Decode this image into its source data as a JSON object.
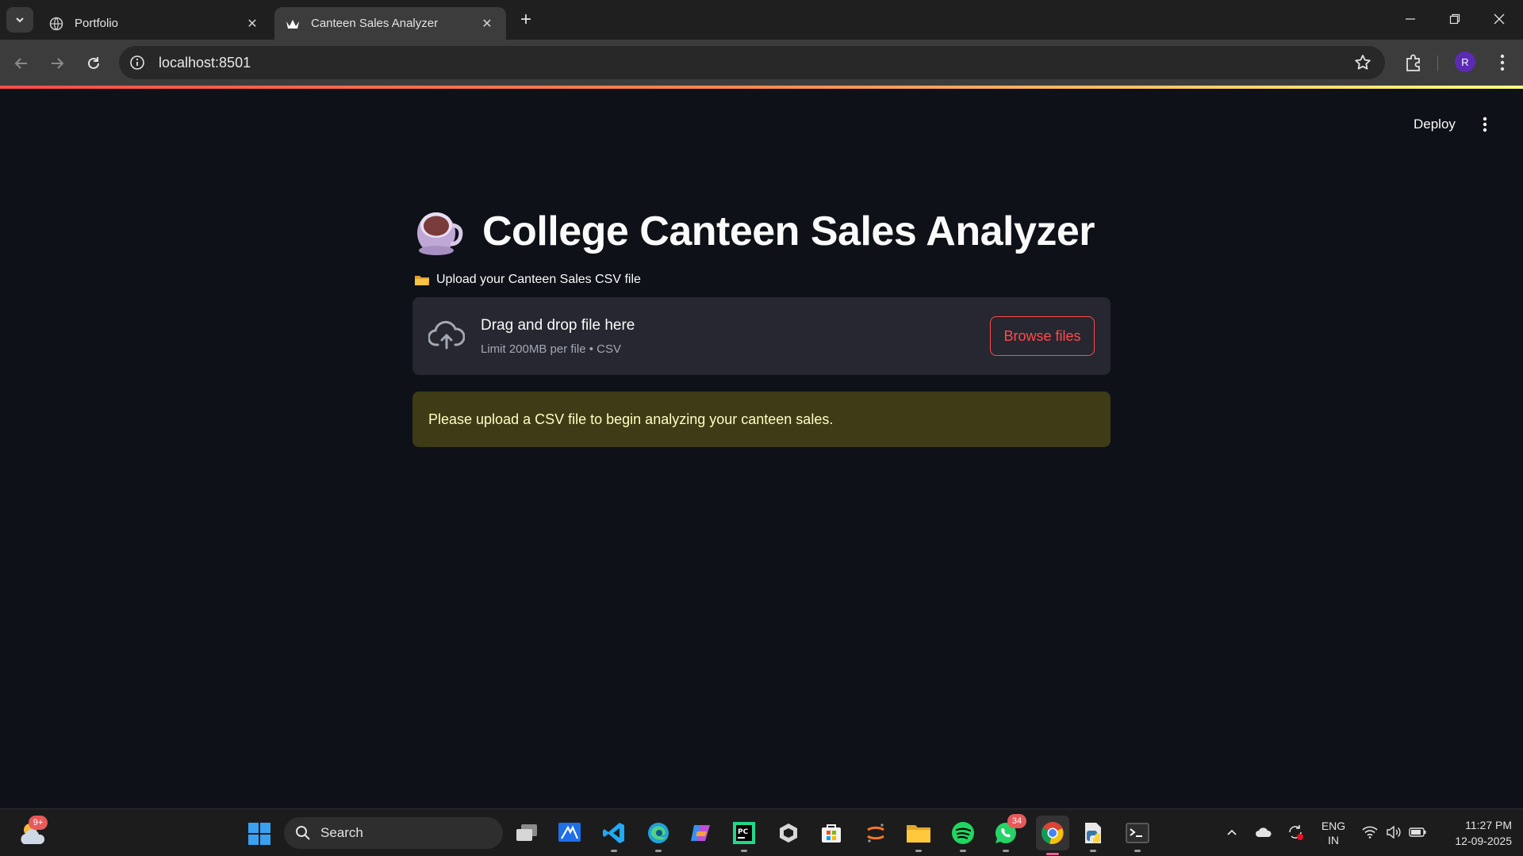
{
  "browser": {
    "tabs": [
      {
        "title": "Portfolio",
        "active": false
      },
      {
        "title": "Canteen Sales Analyzer",
        "active": true
      }
    ],
    "url": "localhost:8501",
    "profile_initial": "R"
  },
  "app": {
    "deploy_label": "Deploy",
    "title": "College Canteen Sales Analyzer",
    "upload_label": "Upload your Canteen Sales CSV file",
    "dropzone_title": "Drag and drop file here",
    "dropzone_limit": "Limit 200MB per file • CSV",
    "browse_label": "Browse files",
    "info_message": "Please upload a CSV file to begin analyzing your canteen sales.",
    "colors": {
      "accent": "#ff4b4b",
      "background": "#0e1117",
      "alert_bg": "#3e3b16",
      "alert_text": "#ffffc2"
    }
  },
  "taskbar": {
    "weather_badge": "9+",
    "search_placeholder": "Search",
    "whatsapp_badge": "34",
    "language_line1": "ENG",
    "language_line2": "IN",
    "time": "11:27 PM",
    "date": "12-09-2025"
  }
}
